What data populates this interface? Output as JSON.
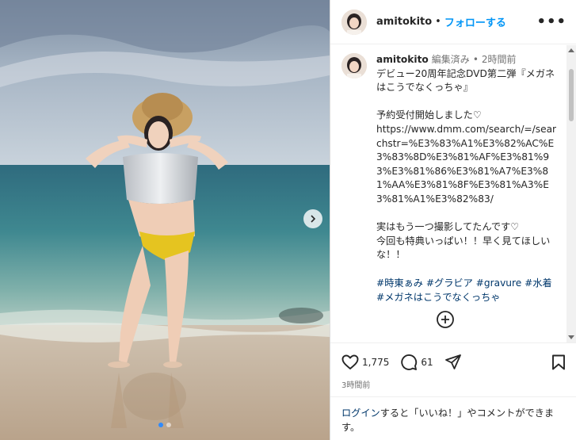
{
  "post": {
    "slide_index": 1,
    "slide_count": 2
  },
  "header": {
    "username": "amitokito",
    "separator": "•",
    "follow_label": "フォローする",
    "more_icon": "more-horizontal-icon"
  },
  "caption": {
    "username": "amitokito",
    "edited": "編集済み",
    "dot": "•",
    "time": "2時間前",
    "text": "デビュー20周年記念DVD第二弾『メガネはこうでなくっちゃ』\n\n予約受付開始しました♡\nhttps://www.dmm.com/search/=/searchstr=%E3%83%A1%E3%82%AC%E3%83%8D%E3%81%AF%E3%81%93%E3%81%86%E3%81%A7%E3%81%AA%E3%81%8F%E3%81%A3%E3%81%A1%E3%82%83/\n\n実はもう一つ撮影してたんです♡\n今回も特典いっぱい！！早く見てほしいな！！",
    "hashtags": "#時東ぁみ #グラビア #gravure #水着 #メガネはこうでなくっちゃ"
  },
  "actions": {
    "like_count": "1,775",
    "comment_count": "61",
    "posted_time": "3時間前"
  },
  "login_prompt": {
    "link": "ログイン",
    "text": "すると「いいね！」やコメントができます。"
  }
}
